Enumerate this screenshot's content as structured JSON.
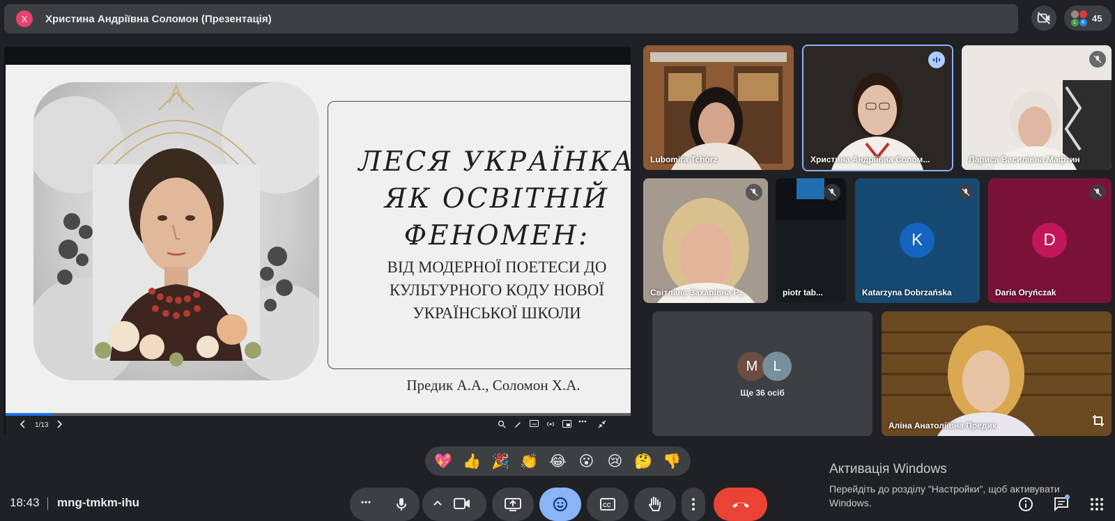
{
  "presenter_bar": {
    "avatar_letter": "Х",
    "title": "Христина Андріївна Соломон (Презентація)"
  },
  "participants_chip": {
    "count": "45",
    "avatar_letters": [
      "L",
      "K"
    ]
  },
  "slide": {
    "title_lines": [
      "ЛЕСЯ УКРАЇНКА",
      "ЯК ОСВІТНІЙ",
      "ФЕНОМЕН:"
    ],
    "subtitle_lines": [
      "ВІД МОДЕРНОЇ ПОЕТЕСИ ДО",
      "КУЛЬТУРНОГО КОДУ НОВОЇ",
      "УКРАЇНСЬКОЇ ШКОЛИ"
    ],
    "authors": "Предик А.А., Соломон Х.А.",
    "page_indicator": "1/13",
    "progress": 0.075
  },
  "tiles": [
    {
      "name": "Lubomira Tchórz",
      "muted": false,
      "speaking": false
    },
    {
      "name": "Христина Андріївна Солом...",
      "muted": false,
      "speaking": true
    },
    {
      "name": "Лариса Василівна Мафтин",
      "muted": true,
      "speaking": false
    },
    {
      "name": "Світлана Захарівна Р...",
      "muted": true,
      "speaking": false
    },
    {
      "name": "piotr tab...",
      "muted": true,
      "speaking": false
    },
    {
      "name": "Katarzyna Dobrzańska",
      "muted": true,
      "avatar_letter": "K",
      "avatar_color": "#1565c0"
    },
    {
      "name": "Daria Oryńczak",
      "muted": true,
      "avatar_letter": "D",
      "avatar_color": "#c2185b"
    },
    {
      "name": "Аліна Анатоліївна Предик",
      "muted": false,
      "speaking": false
    }
  ],
  "others": {
    "letters": [
      "M",
      "L"
    ],
    "label": "Ще 36 осіб"
  },
  "reactions": [
    "💖",
    "👍",
    "🎉",
    "👏",
    "😂",
    "😮",
    "😢",
    "🤔",
    "👎"
  ],
  "meeting": {
    "time": "18:43",
    "code": "mng-tmkm-ihu"
  },
  "activation": {
    "title": "Активація Windows",
    "line2": "Перейдіть до розділу \"Настройки\", щоб активувати",
    "line3": "Windows."
  },
  "colors": {
    "end_call": "#ea4335",
    "active_control": "#8ab4f8",
    "speaking_border": "#8ab4f8"
  }
}
